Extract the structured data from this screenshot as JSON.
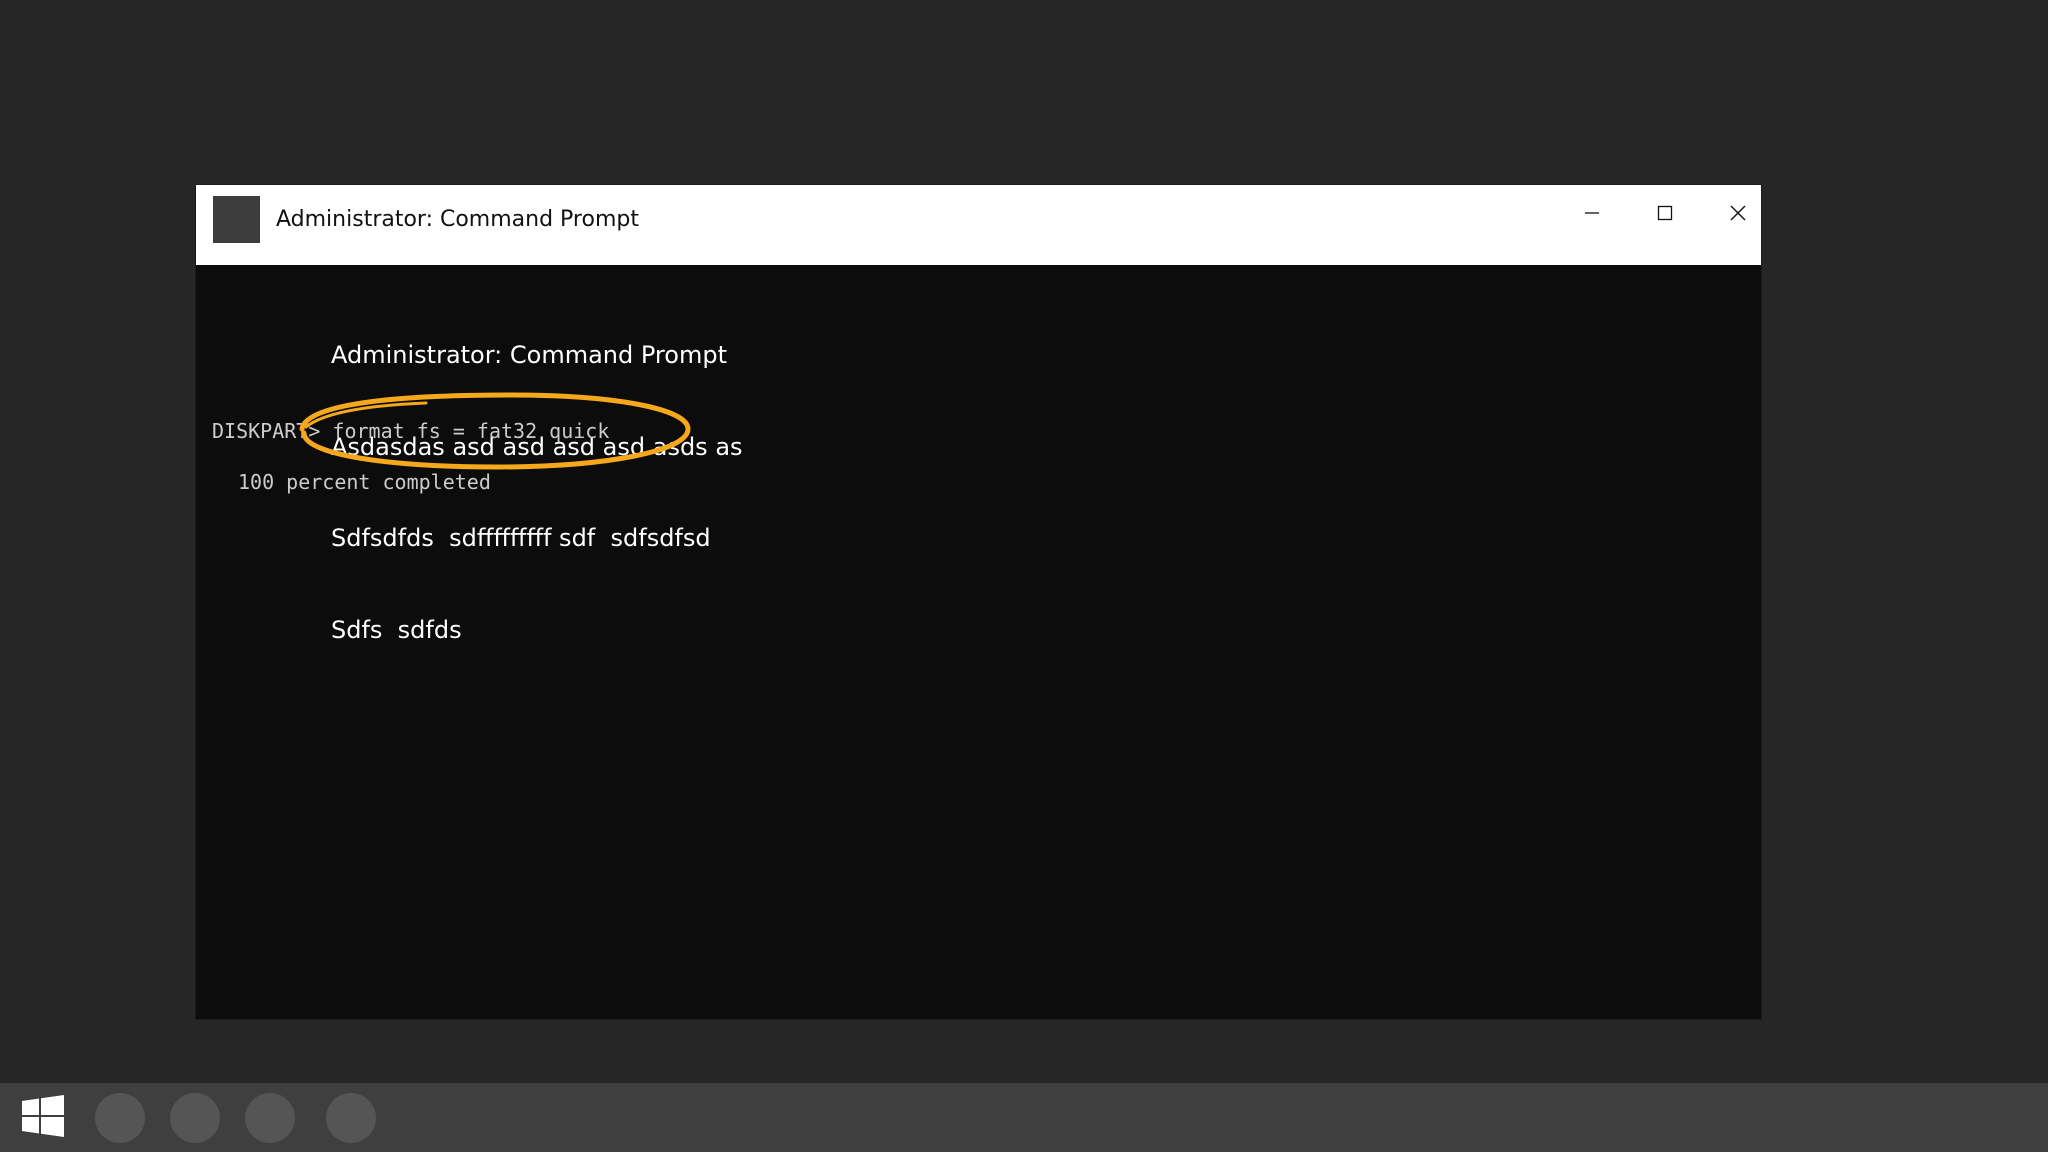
{
  "window": {
    "title": "Administrator: Command Prompt",
    "icon": "console-app-icon",
    "controls": {
      "minimize_icon": "minimize-icon",
      "maximize_icon": "maximize-icon",
      "close_icon": "close-icon"
    }
  },
  "terminal": {
    "notes": [
      "Administrator: Command Prompt",
      "Asdasdas asd asd asd asd asds as",
      "Sdfsdfds  sdfffffffff sdf  sdfsdfsd",
      "Sdfs  sdfds"
    ],
    "prompt": "DISKPART>",
    "command": " format fs = fat32 quick",
    "output": "100 percent completed"
  },
  "annotation": {
    "color": "#f5a81c",
    "shape": "ellipse"
  },
  "colors": {
    "background": "#262626",
    "terminal_bg": "#0c0c0c",
    "terminal_text": "#cccccc",
    "taskbar": "#3f3f3f",
    "titlebar": "#ffffff"
  },
  "taskbar": {
    "start_icon": "windows-logo-icon",
    "pinned_count": 4
  }
}
